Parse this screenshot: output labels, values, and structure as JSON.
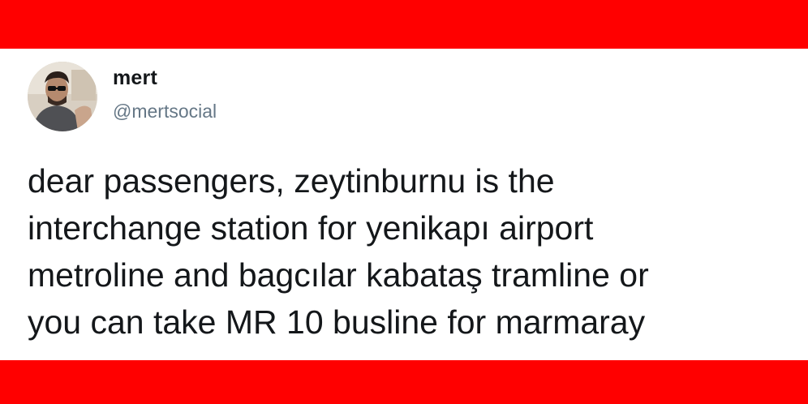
{
  "colors": {
    "band": "#ff0000",
    "card_background": "#ffffff",
    "name_text": "#14171a",
    "handle_text": "#657786",
    "body_text": "#14171a"
  },
  "author": {
    "avatar_icon": "avatar-photo",
    "name": "mert",
    "handle": "@mertsocial"
  },
  "tweet": {
    "lines": [
      "dear passengers, zeytinburnu is the",
      "interchange station for yenikapı airport",
      "metroline and bagcılar kabataş tramline or",
      "you can take MR 10 busline for marmaray"
    ]
  }
}
